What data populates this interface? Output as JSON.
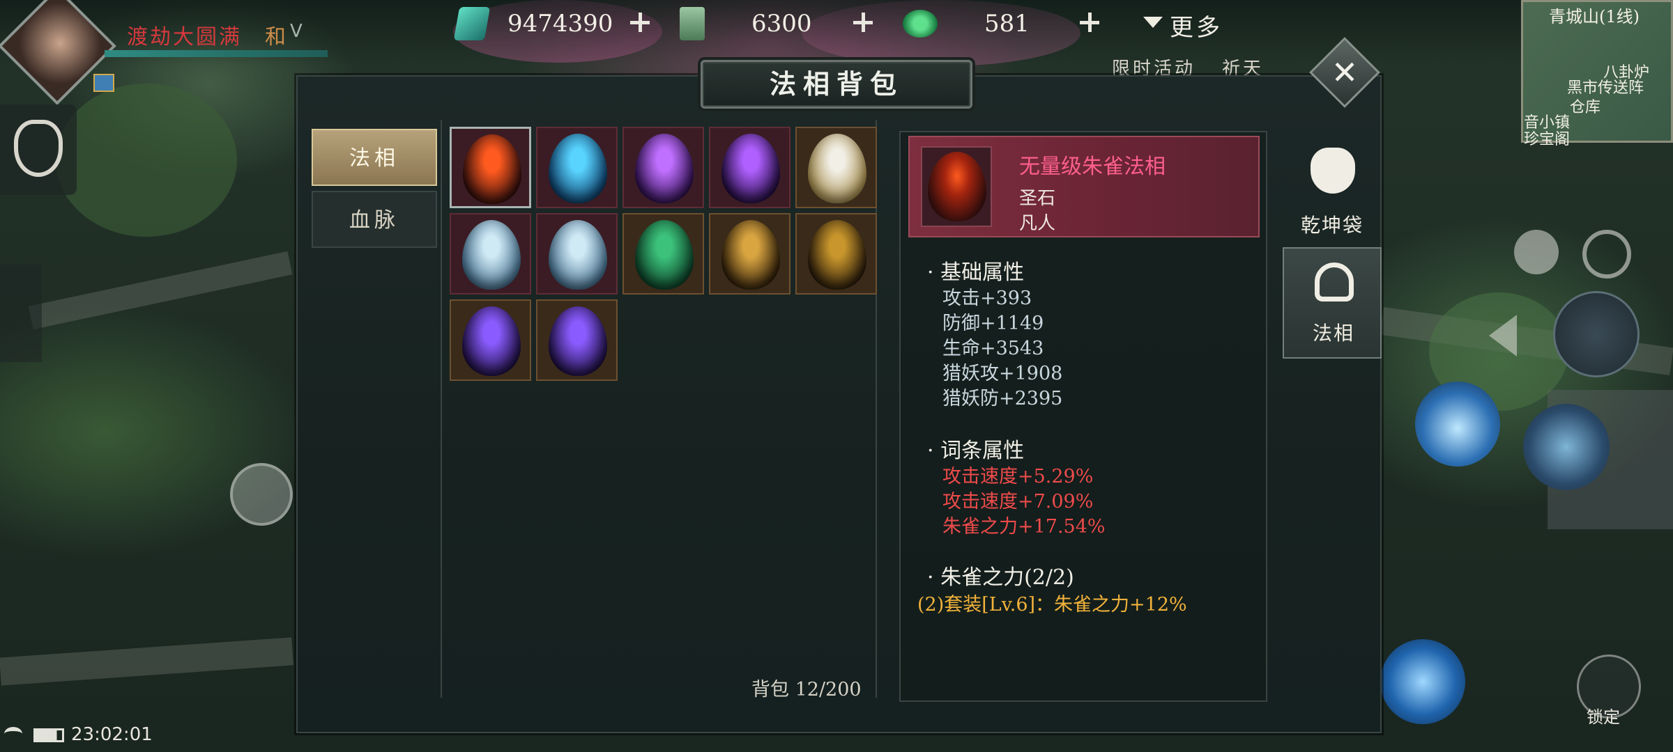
{
  "player": {
    "name": "渡劫大圆满",
    "status_short": "和",
    "status_suffix": "V"
  },
  "resources": [
    {
      "icon": "jade-crystal-icon",
      "value": "9474390"
    },
    {
      "icon": "scroll-ticket-icon",
      "value": "6300"
    },
    {
      "icon": "green-coin-icon",
      "value": "581"
    }
  ],
  "menu": {
    "more_label": "更多"
  },
  "top_menu_labels": [
    "限时活动",
    "祈天"
  ],
  "window": {
    "title": "法相背包"
  },
  "left_tabs": [
    {
      "label": "法相",
      "selected": true
    },
    {
      "label": "血脉",
      "selected": false
    }
  ],
  "inventory": {
    "count_label": "背包",
    "count": "12/200",
    "items": [
      {
        "name": "fire-egg",
        "colors": [
          "#ff5a1f",
          "#2a0c0c"
        ],
        "frame": "red"
      },
      {
        "name": "ice-egg",
        "colors": [
          "#59d4ff",
          "#0a3a66"
        ],
        "frame": "red"
      },
      {
        "name": "violet-flame-egg",
        "colors": [
          "#c070ff",
          "#2a0d4a"
        ],
        "frame": "red"
      },
      {
        "name": "violet-flame-egg",
        "colors": [
          "#b060ff",
          "#1e0a3a"
        ],
        "frame": "red"
      },
      {
        "name": "pearl-gold-egg",
        "colors": [
          "#f1efe6",
          "#a68b47"
        ],
        "frame": "gold"
      },
      {
        "name": "silver-crystal-egg",
        "colors": [
          "#cfe9f5",
          "#3f6b8a"
        ],
        "frame": "red"
      },
      {
        "name": "silver-crystal-egg",
        "colors": [
          "#cfe9f5",
          "#3f6b8a"
        ],
        "frame": "red"
      },
      {
        "name": "jade-scale-egg",
        "colors": [
          "#3cc27b",
          "#0b3b24"
        ],
        "frame": "gold"
      },
      {
        "name": "gold-scale-egg",
        "colors": [
          "#d9a541",
          "#2a1a07"
        ],
        "frame": "gold"
      },
      {
        "name": "gold-scale-egg",
        "colors": [
          "#c8962c",
          "#24170a"
        ],
        "frame": "gold"
      },
      {
        "name": "purple-scale-egg",
        "colors": [
          "#8a5cff",
          "#1a0d3a"
        ],
        "frame": "gold"
      },
      {
        "name": "purple-scale-egg",
        "colors": [
          "#8a5cff",
          "#1a0d3a"
        ],
        "frame": "gold"
      }
    ]
  },
  "detail": {
    "name": "无量级朱雀法相",
    "type": "圣石",
    "realm": "凡人",
    "base_title": "基础属性",
    "base_stats": [
      "攻击+393",
      "防御+1149",
      "生命+3543",
      "猎妖攻+1908",
      "猎妖防+2395"
    ],
    "affix_title": "词条属性",
    "affix_stats": [
      "攻击速度+5.29%",
      "攻击速度+7.09%",
      "朱雀之力+17.54%"
    ],
    "set_title": "朱雀之力(2/2)",
    "set_bonus": "(2)套装[Lv.6]：朱雀之力+12%"
  },
  "right_tabs": [
    {
      "label": "乾坤袋",
      "icon": "pouch-icon",
      "selected": false
    },
    {
      "label": "法相",
      "icon": "mask-icon",
      "selected": true
    }
  ],
  "hud": {
    "time": "23:02:01",
    "map_name": "青城山(1线)",
    "map_labels": [
      "八卦炉",
      "黑市传送阵",
      "仓库",
      "音小镇",
      "珍宝阁"
    ],
    "lock_label": "锁定"
  }
}
